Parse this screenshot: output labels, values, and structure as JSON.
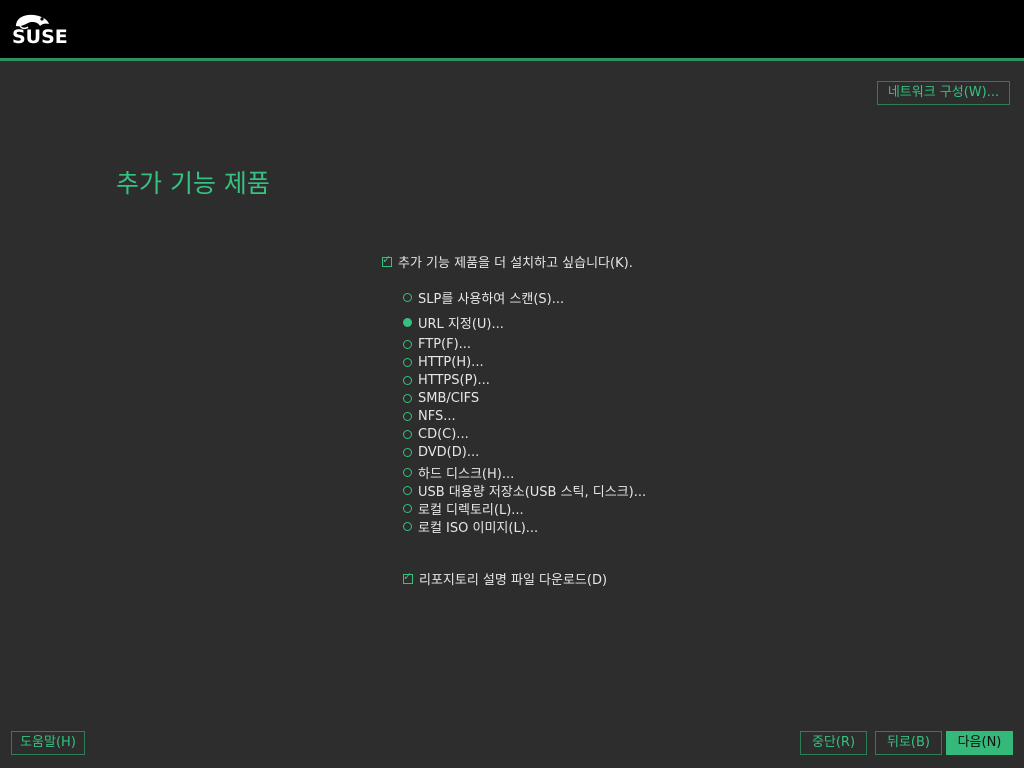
{
  "brand": {
    "logo_text": "SUSE"
  },
  "header": {
    "network_button": "네트워크 구성(W)..."
  },
  "page": {
    "title": "추가 기능 제품"
  },
  "main_checkbox": {
    "label": "추가 기능 제품을 더 설치하고 싶습니다(K).",
    "checked": true
  },
  "options": [
    {
      "label": "SLP를 사용하여 스캔(S)...",
      "selected": false
    },
    {
      "label": "URL 지정(U)...",
      "selected": true
    },
    {
      "label": "FTP(F)...",
      "selected": false
    },
    {
      "label": "HTTP(H)...",
      "selected": false
    },
    {
      "label": "HTTPS(P)...",
      "selected": false
    },
    {
      "label": "SMB/CIFS",
      "selected": false
    },
    {
      "label": "NFS...",
      "selected": false
    },
    {
      "label": "CD(C)...",
      "selected": false
    },
    {
      "label": "DVD(D)...",
      "selected": false
    },
    {
      "label": "하드 디스크(H)...",
      "selected": false
    },
    {
      "label": "USB 대용량 저장소(USB 스틱, 디스크)...",
      "selected": false
    },
    {
      "label": "로컬 디렉토리(L)...",
      "selected": false
    },
    {
      "label": "로컬 ISO 이미지(L)...",
      "selected": false
    }
  ],
  "download_checkbox": {
    "label": "리포지토리 설명 파일 다운로드(D)",
    "checked": true
  },
  "footer": {
    "help": "도움말(H)",
    "abort": "중단(R)",
    "back": "뒤로(B)",
    "next": "다음(N)"
  },
  "colors": {
    "accent": "#35c17f",
    "background": "#2d2d2d",
    "topbar": "#000000"
  }
}
